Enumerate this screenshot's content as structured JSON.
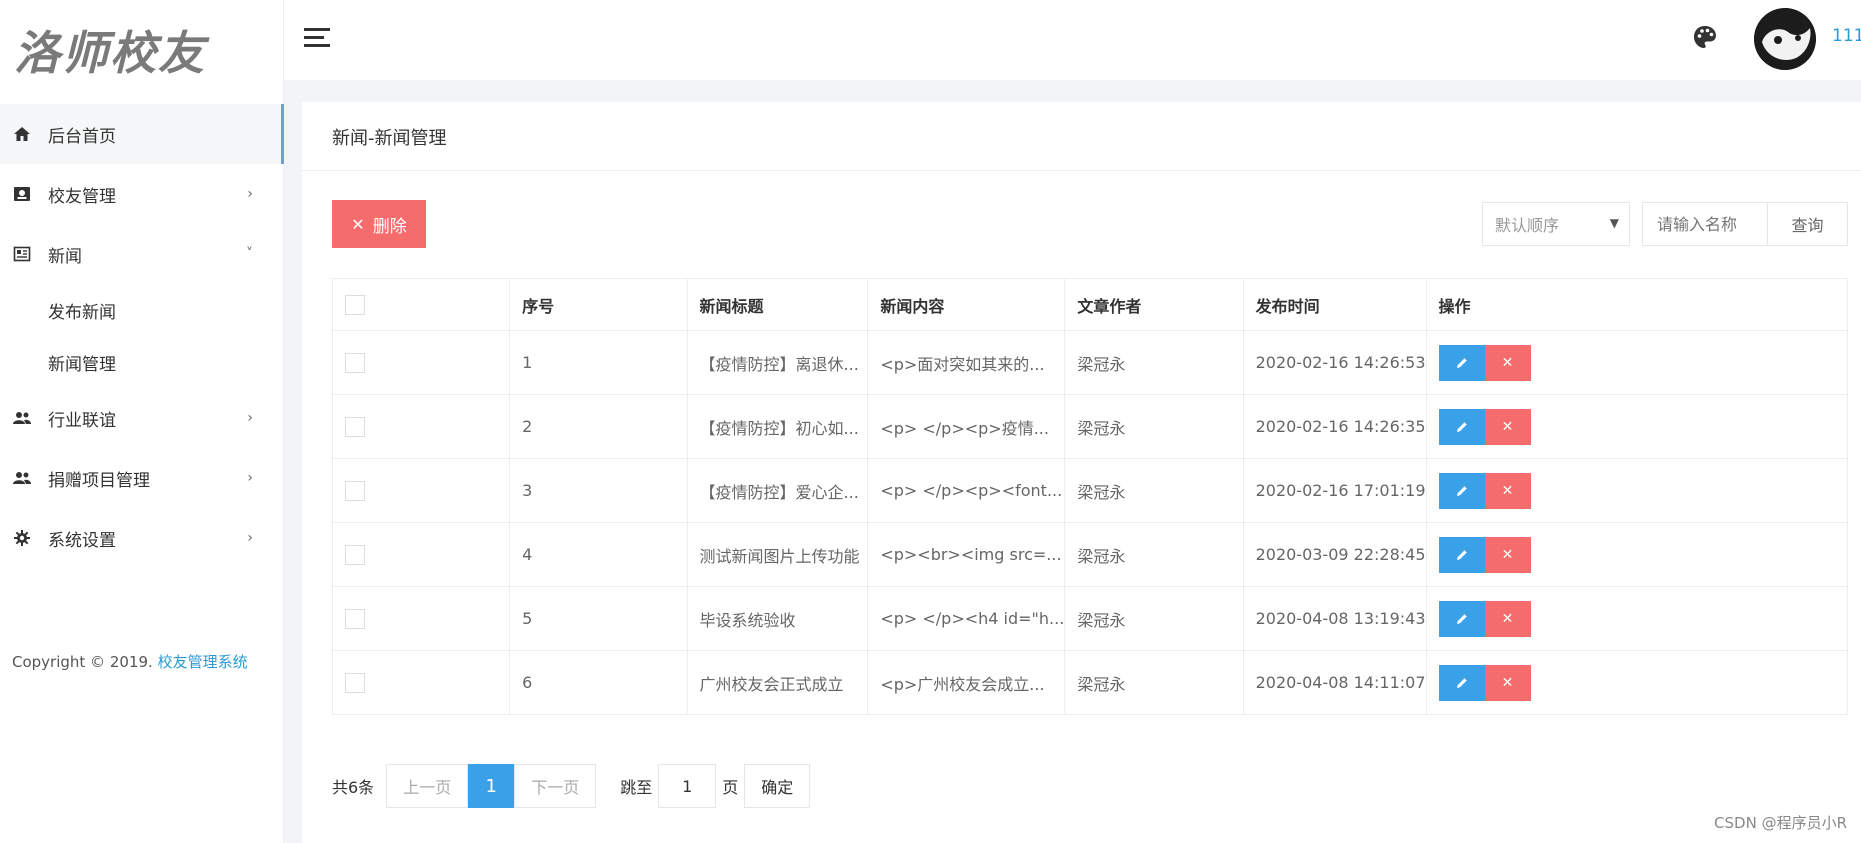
{
  "logo": {
    "text": "洛师校友"
  },
  "sidebar": {
    "items": [
      {
        "label": "后台首页",
        "icon": "home-icon",
        "arrow": ""
      },
      {
        "label": "校友管理",
        "icon": "contact-card-icon",
        "arrow": "›"
      },
      {
        "label": "新闻",
        "icon": "newspaper-icon",
        "arrow": "˅"
      },
      {
        "label": "行业联谊",
        "icon": "users-icon",
        "arrow": "›"
      },
      {
        "label": "捐赠项目管理",
        "icon": "users-icon",
        "arrow": "›"
      },
      {
        "label": "系统设置",
        "icon": "gear-icon",
        "arrow": "›"
      }
    ],
    "subitems": [
      "发布新闻",
      "新闻管理"
    ],
    "copyright_prefix": "Copyright © 2019.",
    "copyright_link": "校友管理系统"
  },
  "header": {
    "username": "111"
  },
  "page": {
    "breadcrumb": "新闻-新闻管理"
  },
  "toolbar": {
    "delete_label": "删除",
    "sort_value": "默认顺序",
    "search_placeholder": "请输入名称",
    "search_label": "查询"
  },
  "table": {
    "headers": [
      "序号",
      "新闻标题",
      "新闻内容",
      "文章作者",
      "发布时间",
      "操作"
    ],
    "rows": [
      {
        "no": "1",
        "title": "【疫情防控】离退休...",
        "content": "<p>面对突如其来的...",
        "author": "梁冠永",
        "time": "2020-02-16 14:26:53"
      },
      {
        "no": "2",
        "title": "【疫情防控】初心如...",
        "content": "<p> </p><p>疫情...",
        "author": "梁冠永",
        "time": "2020-02-16 14:26:35"
      },
      {
        "no": "3",
        "title": "【疫情防控】爱心企...",
        "content": "<p> </p><p><font...",
        "author": "梁冠永",
        "time": "2020-02-16 17:01:19"
      },
      {
        "no": "4",
        "title": "测试新闻图片上传功能",
        "content": "<p><br><img src=...",
        "author": "梁冠永",
        "time": "2020-03-09 22:28:45"
      },
      {
        "no": "5",
        "title": "毕设系统验收",
        "content": "<p> </p><h4 id=\"h...",
        "author": "梁冠永",
        "time": "2020-04-08 13:19:43"
      },
      {
        "no": "6",
        "title": "广州校友会正式成立",
        "content": "<p>广州校友会成立...",
        "author": "梁冠永",
        "time": "2020-04-08 14:11:07"
      }
    ]
  },
  "pager": {
    "total": "共6条",
    "prev": "上一页",
    "current": "1",
    "next": "下一页",
    "jump_label": "跳至",
    "jump_value": "1",
    "page_label": "页",
    "ok_label": "确定"
  },
  "footer": {
    "watermark": "CSDN @程序员小R"
  },
  "colors": {
    "accent": "#3aa0e8",
    "danger": "#f56c6c",
    "link": "#2a9bd3"
  }
}
